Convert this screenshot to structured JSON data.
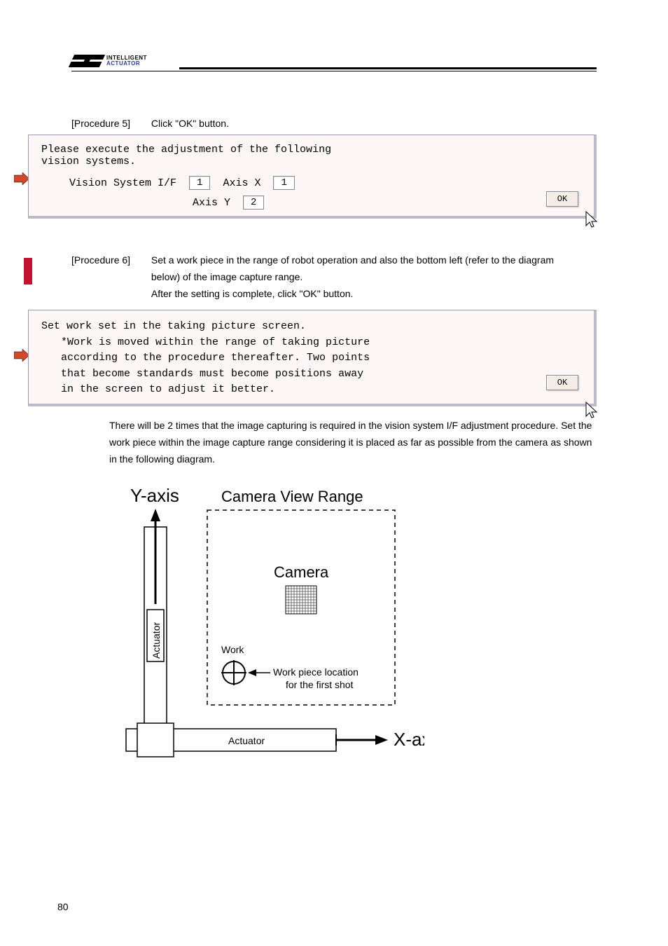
{
  "header": {
    "logo_line1": "INTELLIGENT",
    "logo_line2": "ACTUATOR"
  },
  "procedure5": {
    "label": "[Procedure 5]",
    "text": "Click \"OK\" button."
  },
  "dialog1": {
    "line1": "Please execute the adjustment of the following",
    "line2": "vision systems.",
    "vs_label": "Vision System I/F",
    "vs_value": "1",
    "axis_x_label": "Axis X",
    "axis_x_value": "1",
    "axis_y_label": "Axis Y",
    "axis_y_value": "2",
    "ok": "OK"
  },
  "procedure6": {
    "label": "[Procedure 6]",
    "line1": "Set a work piece in the range of robot operation and also the bottom left (refer to the",
    "line2": "diagram below) of the image capture range.",
    "line3": "After the setting is complete, click \"OK\" button."
  },
  "dialog2": {
    "line1": "Set work set in the taking picture screen.",
    "note1": "*Work is moved within the range of taking picture",
    "note2": " according to the procedure thereafter. Two points",
    "note3": " that become standards must become positions away",
    "note4": " in the screen to adjust it better.",
    "ok": "OK"
  },
  "explain": {
    "text": "There will be 2 times that the image capturing is required in the vision system I/F adjustment procedure. Set the work piece within the image capture range considering it is placed as far as possible from the camera as shown in the following diagram."
  },
  "diagram": {
    "y_axis": "Y-axis",
    "x_axis": "X-axis",
    "camera_range": "Camera View Range",
    "camera": "Camera",
    "actuator_v": "Actuator",
    "actuator_h": "Actuator",
    "work": "Work",
    "work_loc1": "Work piece location",
    "work_loc2": "for the first shot"
  },
  "page_number": "80"
}
